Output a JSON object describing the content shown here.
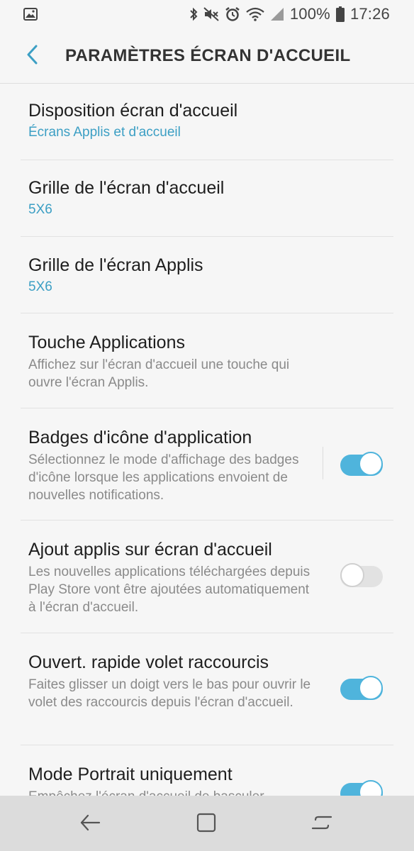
{
  "status_bar": {
    "battery": "100%",
    "time": "17:26",
    "icons": [
      "gallery-icon",
      "bluetooth-icon",
      "mute-icon",
      "alarm-icon",
      "wifi-icon",
      "signal-icon",
      "battery-icon"
    ]
  },
  "header": {
    "title": "PARAMÈTRES ÉCRAN D'ACCUEIL"
  },
  "items": [
    {
      "title": "Disposition écran d'accueil",
      "value": "Écrans Applis et d'accueil"
    },
    {
      "title": "Grille de l'écran d'accueil",
      "value": "5X6"
    },
    {
      "title": "Grille de l'écran Applis",
      "value": "5X6"
    },
    {
      "title": "Touche Applications",
      "description": "Affichez sur l'écran d'accueil une touche qui ouvre l'écran Applis."
    },
    {
      "title": "Badges d'icône d'application",
      "description": "Sélectionnez le mode d'affichage des badges d'icône lorsque les applications envoient de nouvelles notifications.",
      "toggle": true
    },
    {
      "title": "Ajout applis sur écran d'accueil",
      "description": "Les nouvelles applications téléchargées depuis Play Store vont être ajoutées automatiquement à l'écran d'accueil.",
      "toggle": false
    },
    {
      "title": "Ouvert. rapide volet raccourcis",
      "description": "Faites glisser un doigt vers le bas pour ouvrir le volet des raccourcis depuis l'écran d'accueil.",
      "toggle": true
    },
    {
      "title": "Mode Portrait uniquement",
      "description": "Empêchez l'écran d'accueil de basculer",
      "toggle": true
    }
  ],
  "colors": {
    "accent": "#3c9fc4",
    "toggle_on": "#4fb4dc",
    "background": "#f6f6f6"
  }
}
